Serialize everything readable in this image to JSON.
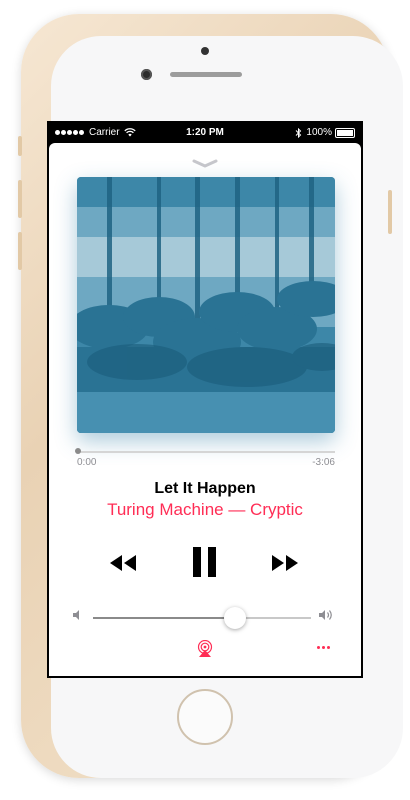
{
  "status_bar": {
    "carrier": "Carrier",
    "time": "1:20 PM",
    "battery_text": "100%"
  },
  "now_playing": {
    "title": "Let It Happen",
    "artist_album": "Turing Machine — Cryptic",
    "elapsed": "0:00",
    "remaining": "-3:06",
    "progress": 0.0,
    "volume": 0.65,
    "accent_color": "#ff2d55"
  },
  "icons": {
    "collapse": "chevron-down-icon",
    "previous": "rewind-icon",
    "play_pause": "pause-icon",
    "next": "fast-forward-icon",
    "volume_min": "speaker-low-icon",
    "volume_max": "speaker-high-icon",
    "airplay": "airplay-icon",
    "more": "more-icon"
  }
}
